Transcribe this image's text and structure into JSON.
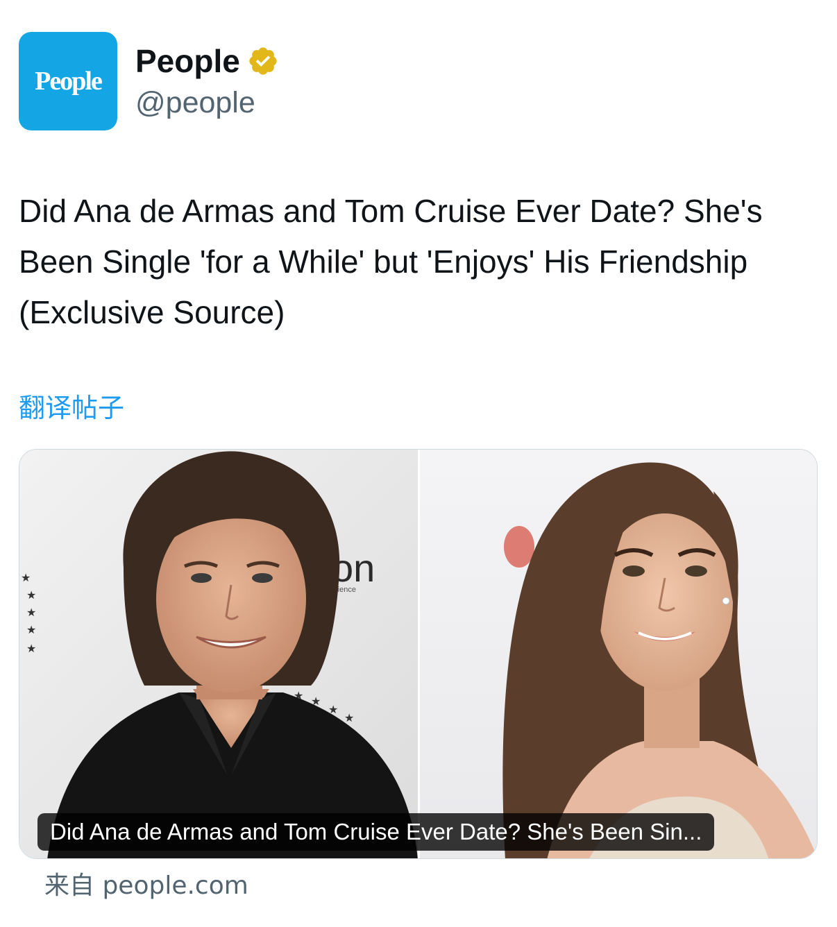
{
  "account": {
    "avatar_text": "People",
    "display_name": "People",
    "handle": "@people",
    "verified": true,
    "verified_icon": "gold-verified-badge-icon",
    "avatar_color": "#14a6e4"
  },
  "tweet": {
    "text": "Did Ana de Armas and Tom Cruise Ever Date? She's Been Single 'for a While' but 'Enjoys' His Friendship (Exclusive Source)",
    "translate_label": "翻译帖子"
  },
  "link_card": {
    "caption": "Did Ana de Armas and Tom Cruise Ever Date? She's Been Sin...",
    "source": "来自 people.com",
    "images": [
      "left-photo-man-dark-hair-black-shirt",
      "right-photo-woman-long-brown-hair"
    ]
  },
  "colors": {
    "link_blue": "#1d9bf0",
    "secondary_text": "#536471",
    "primary_text": "#0f1419",
    "verified_gold": "#e2b719"
  }
}
